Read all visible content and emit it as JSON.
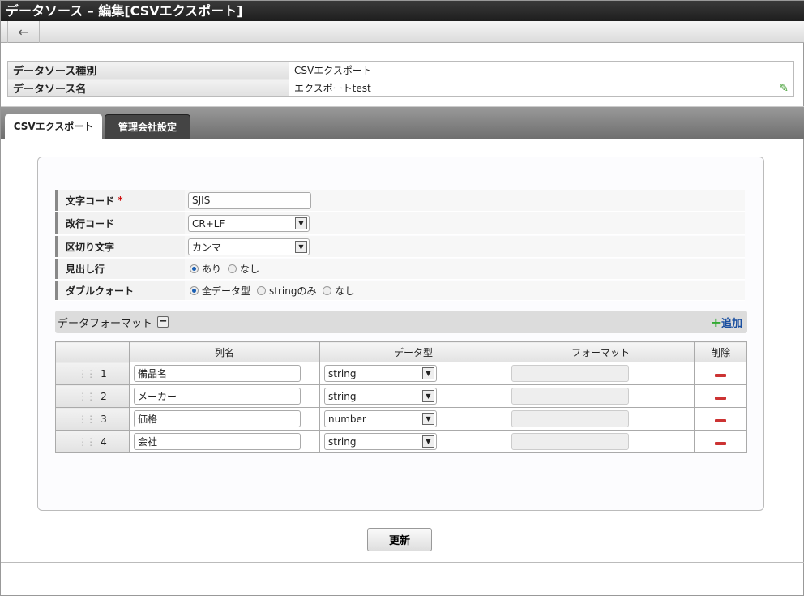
{
  "title": "データソース – 編集[CSVエクスポート]",
  "toolbar": {
    "back_icon": "←"
  },
  "info": {
    "rows": [
      {
        "label": "データソース種別",
        "value": "CSVエクスポート"
      },
      {
        "label": "データソース名",
        "value": "エクスポートtest"
      }
    ],
    "edit_icon": "✎"
  },
  "tabs": [
    {
      "label": "CSVエクスポート"
    },
    {
      "label": "管理会社設定"
    }
  ],
  "form": {
    "charset": {
      "label": "文字コード",
      "required": "*",
      "value": "SJIS"
    },
    "newline": {
      "label": "改行コード",
      "value": "CR+LF"
    },
    "delimiter": {
      "label": "区切り文字",
      "value": "カンマ"
    },
    "header": {
      "label": "見出し行",
      "options": [
        "あり",
        "なし"
      ]
    },
    "quote": {
      "label": "ダブルクォート",
      "options": [
        "全データ型",
        "stringのみ",
        "なし"
      ]
    }
  },
  "format": {
    "title": "データフォーマット",
    "collapse": "−",
    "add_label": "追加",
    "add_icon": "+",
    "columns": [
      "",
      "列名",
      "データ型",
      "フォーマット",
      "削除"
    ],
    "rows": [
      {
        "no": "1",
        "name": "備品名",
        "type": "string"
      },
      {
        "no": "2",
        "name": "メーカー",
        "type": "string"
      },
      {
        "no": "3",
        "name": "価格",
        "type": "number"
      },
      {
        "no": "4",
        "name": "会社",
        "type": "string"
      }
    ]
  },
  "update_label": "更新"
}
